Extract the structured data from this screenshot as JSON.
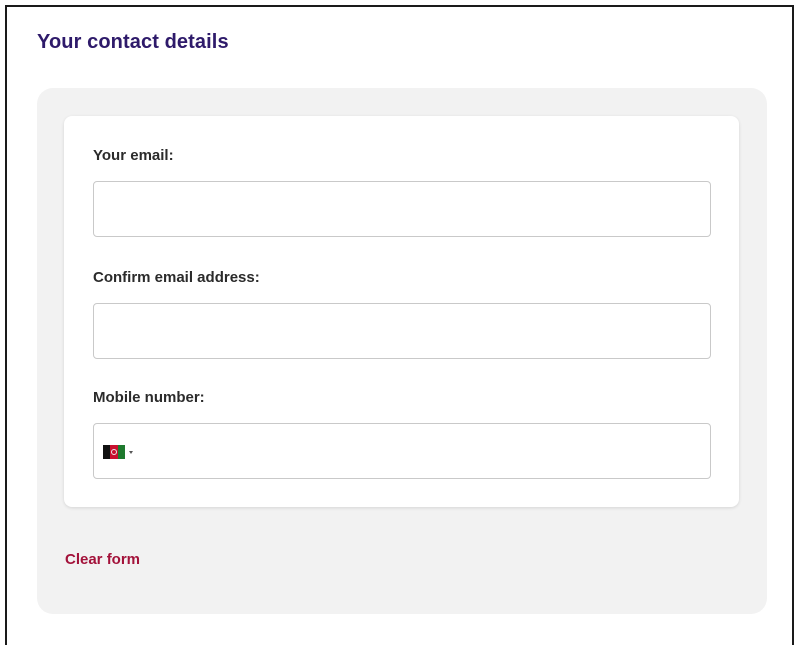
{
  "section": {
    "title": "Your contact details"
  },
  "form": {
    "email": {
      "label": "Your email:",
      "value": "",
      "placeholder": ""
    },
    "confirm_email": {
      "label": "Confirm email address:",
      "value": "",
      "placeholder": ""
    },
    "mobile": {
      "label": "Mobile number:",
      "value": "",
      "placeholder": "",
      "country_flag_icon": "afghanistan-flag-icon",
      "flag_colors": [
        "#111111",
        "#c8102e",
        "#1e7a2e"
      ]
    }
  },
  "actions": {
    "clear_label": "Clear form"
  },
  "colors": {
    "title": "#2e1a6a",
    "link": "#a3123a",
    "panel_bg": "#f2f2f2"
  }
}
